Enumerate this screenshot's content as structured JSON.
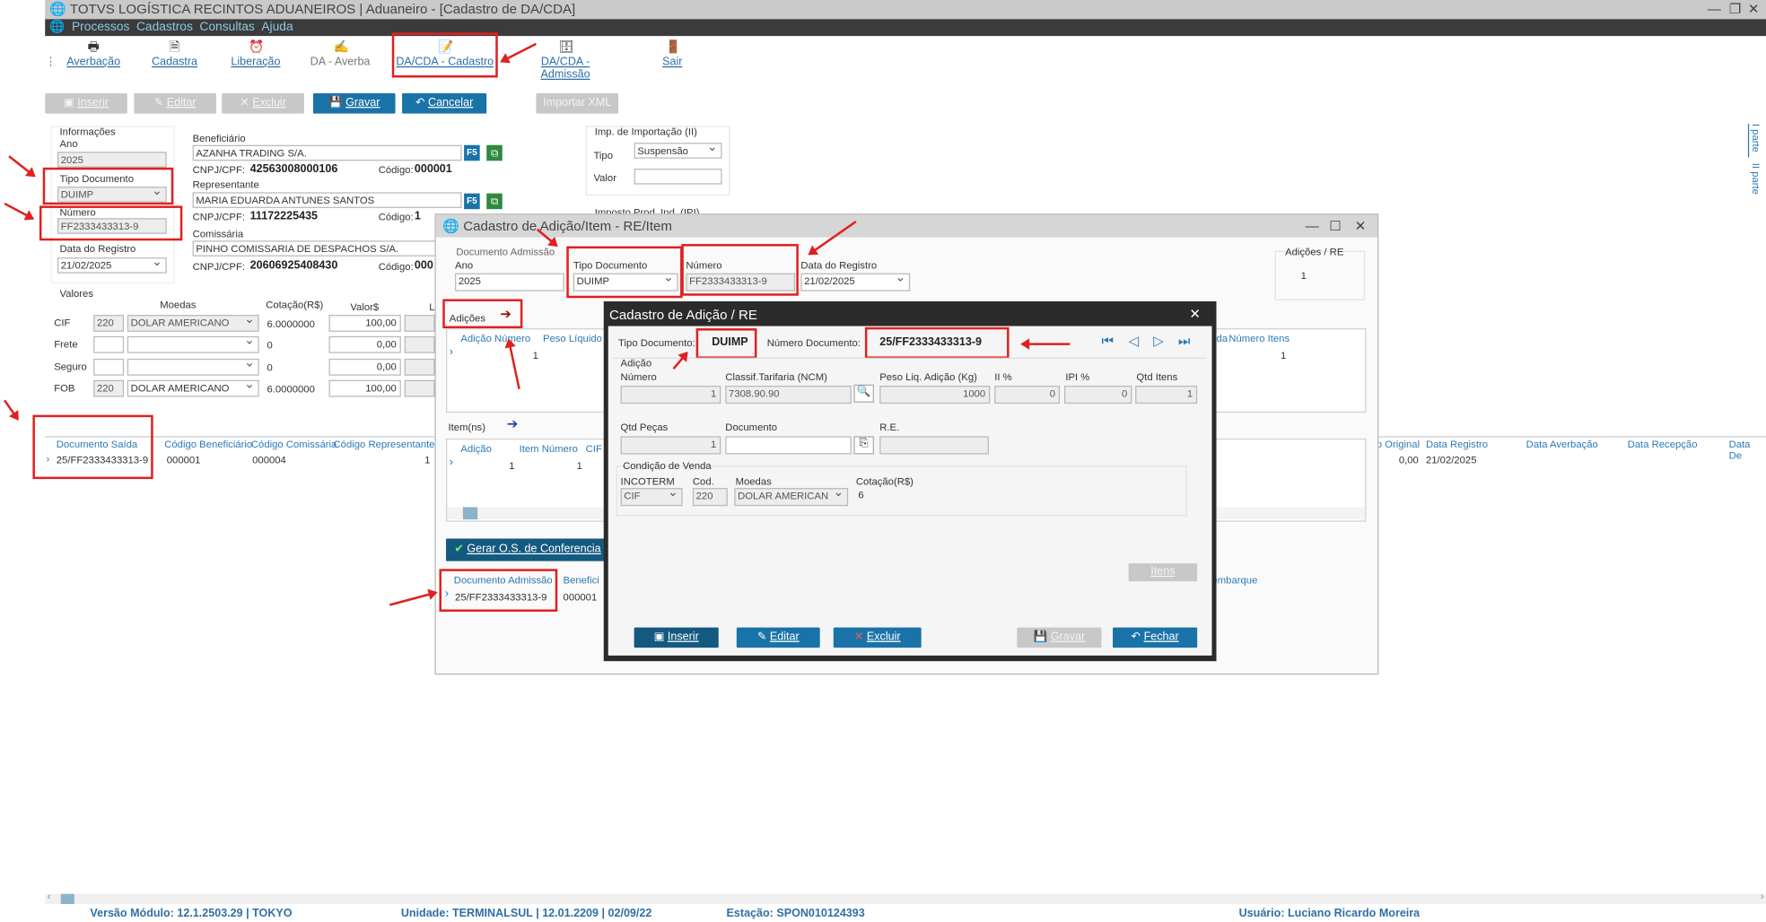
{
  "app": {
    "title": "TOTVS LOGÍSTICA RECINTOS ADUANEIROS | Aduaneiro - [Cadastro de DA/CDA]",
    "menu": [
      "Processos",
      "Cadastros",
      "Consultas",
      "Ajuda"
    ]
  },
  "toolbar": [
    "Averbação",
    "Cadastra",
    "Liberação",
    "DA - Averba",
    "DA/CDA - Cadastro",
    "DA/CDA - Admissão",
    "Sair"
  ],
  "actions": {
    "inserir": "Inserir",
    "editar": "Editar",
    "excluir": "Excluir",
    "gravar": "Gravar",
    "cancelar": "Cancelar",
    "importar": "Importar XML"
  },
  "info": {
    "title": "Informações",
    "ano_label": "Ano",
    "ano": "2025",
    "tipo_label": "Tipo Documento",
    "tipo": "DUIMP",
    "numero_label": "Número",
    "numero": "FF2333433313-9",
    "data_label": "Data do Registro",
    "data": "21/02/2025"
  },
  "benef": {
    "label": "Beneficiário",
    "name": "AZANHA TRADING S/A.",
    "cnpj_label": "CNPJ/CPF:",
    "cnpj": "42563008000106",
    "cod_label": "Código:",
    "cod": "000001"
  },
  "repres": {
    "label": "Representante",
    "name": "MARIA EDUARDA ANTUNES SANTOS",
    "cnpj_label": "CNPJ/CPF:",
    "cnpj": "11172225435",
    "cod_label": "Código:",
    "cod": "1"
  },
  "comiss": {
    "label": "Comissária",
    "name": "PINHO COMISSARIA DE DESPACHOS S/A.",
    "cnpj_label": "CNPJ/CPF:",
    "cnpj": "20606925408430",
    "cod_label": "Código:",
    "cod": "000"
  },
  "imp": {
    "title": "Imp. de Importação (II)",
    "tipo_label": "Tipo",
    "tipo": "Suspensão",
    "valor_label": "Valor",
    "ipi": "Imposto Prod. Ind. (IPI)"
  },
  "f5": "F5",
  "valores": {
    "title": "Valores",
    "moedas": "Moedas",
    "cotacao": "Cotação(R$)",
    "valor": "Valor$",
    "l": "L",
    "rows": [
      {
        "label": "CIF",
        "cod": "220",
        "moeda": "DOLAR AMERICANO",
        "cot": "6.0000000",
        "val": "100,00"
      },
      {
        "label": "Frete",
        "cod": "",
        "moeda": "",
        "cot": "0",
        "val": "0,00"
      },
      {
        "label": "Seguro",
        "cod": "",
        "moeda": "",
        "cot": "0",
        "val": "0,00"
      },
      {
        "label": "FOB",
        "cod": "220",
        "moeda": "DOLAR AMERICANO",
        "cot": "6.0000000",
        "val": "100,00"
      }
    ]
  },
  "grid": {
    "cols": [
      "Documento Saída",
      "Código Beneficiário",
      "Código Comissária",
      "Código Representante"
    ],
    "row": [
      "25/FF2333433313-9",
      "000001",
      "000004",
      "1"
    ],
    "right_cols": [
      "o Original",
      "Data Registro",
      "Data Averbação",
      "Data Recepção",
      "Data De"
    ],
    "right_row": [
      "0,00",
      "21/02/2025"
    ]
  },
  "side": [
    "I parte",
    "II parte"
  ],
  "status": {
    "versao": "Versão Módulo:  12.1.2503.29  |  TOKYO",
    "unidade": "Unidade: TERMINALSUL | 12.01.2209 | 02/09/22",
    "estacao": "Estação: SPON010124393",
    "usuario": "Usuário: Luciano Ricardo Moreira"
  },
  "win1": {
    "title": "Cadastro de Adição/Item - RE/Item",
    "doc_label": "Documento  Admissão",
    "ano_label": "Ano",
    "ano": "2025",
    "tipo_label": "Tipo Documento",
    "tipo": "DUIMP",
    "numero_label": "Número",
    "numero": "FF2333433313-9",
    "data_label": "Data do Registro",
    "data": "21/02/2025",
    "adicoes_re": "Adições / RE",
    "adicoes_re_val": "1",
    "adicoes": "Adições",
    "ad_cols": [
      "Adição Número",
      "Peso Líquido"
    ],
    "ad_row": [
      "1"
    ],
    "num_itens": "Número Itens",
    "num_itens_val": "1",
    "da": "da",
    "itens": "Item(ns)",
    "it_cols": [
      "Adição",
      "Item Número",
      "CIF"
    ],
    "it_row": [
      "1",
      "1"
    ],
    "gerar": "Gerar O.S. de Conferencia",
    "adm_cols": [
      "Documento Admissão",
      "Benefici"
    ],
    "adm_row": [
      "25/FF2333433313-9",
      "000001"
    ],
    "embarque": "embarque"
  },
  "win2": {
    "title": "Cadastro de Adição / RE",
    "tipo_label": "Tipo Documento:",
    "tipo": "DUIMP",
    "num_label": "Número Documento:",
    "num": "25/FF2333433313-9",
    "adicao": "Adição",
    "numero_label": "Número",
    "numero": "1",
    "ncm_label": "Classif.Tarifaria  (NCM)",
    "ncm": "7308.90.90",
    "peso_label": "Peso Liq. Adição (Kg)",
    "peso": "1000",
    "ii_label": "II %",
    "ii": "0",
    "ipi_label": "IPI %",
    "ipi": "0",
    "qtd_label": "Qtd Itens",
    "qtd": "1",
    "pecas_label": "Qtd Peças",
    "pecas": "1",
    "doc_label": "Documento",
    "re_label": "R.E.",
    "cond": "Condição de Venda",
    "inco_label": "INCOTERM",
    "inco": "CIF",
    "cod_label": "Cod.",
    "cod": "220",
    "moedas_label": "Moedas",
    "moeda": "DOLAR AMERICAN",
    "cot_label": "Cotação(R$)",
    "cot": "6",
    "itens": "Itens",
    "inserir": "Inserir",
    "editar": "Editar",
    "excluir": "Excluir",
    "gravar": "Gravar",
    "fechar": "Fechar"
  }
}
